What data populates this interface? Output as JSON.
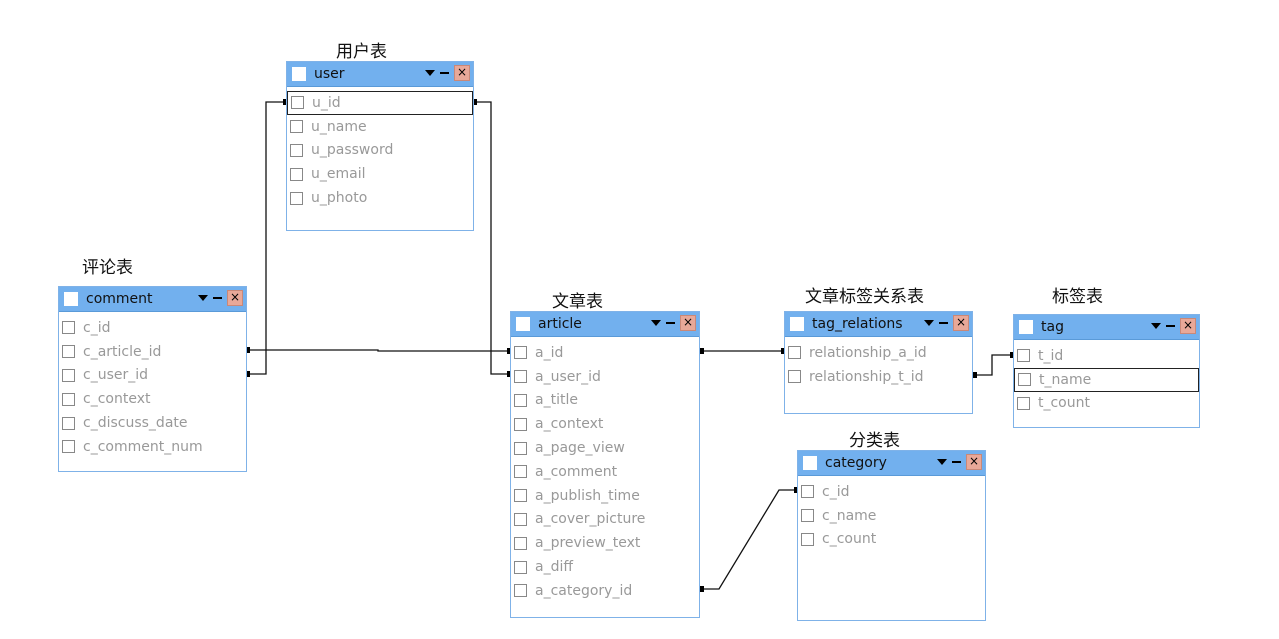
{
  "tables": [
    {
      "id": "user",
      "caption": "用户表",
      "name": "user",
      "fields": [
        "u_id",
        "u_name",
        "u_password",
        "u_email",
        "u_photo"
      ],
      "selected": 0
    },
    {
      "id": "comment",
      "caption": "评论表",
      "name": "comment",
      "fields": [
        "c_id",
        "c_article_id",
        "c_user_id",
        "c_context",
        "c_discuss_date",
        "c_comment_num"
      ],
      "selected": -1
    },
    {
      "id": "article",
      "caption": "文章表",
      "name": "article",
      "fields": [
        "a_id",
        "a_user_id",
        "a_title",
        "a_context",
        "a_page_view",
        "a_comment",
        "a_publish_time",
        "a_cover_picture",
        "a_preview_text",
        "a_diff",
        "a_category_id"
      ],
      "selected": -1
    },
    {
      "id": "tag_relations",
      "caption": "文章标签关系表",
      "name": "tag_relations",
      "fields": [
        "relationship_a_id",
        "relationship_t_id"
      ],
      "selected": -1
    },
    {
      "id": "tag",
      "caption": "标签表",
      "name": "tag",
      "fields": [
        "t_id",
        "t_name",
        "t_count"
      ],
      "selected": 1
    },
    {
      "id": "category",
      "caption": "分类表",
      "name": "category",
      "fields": [
        "c_id",
        "c_name",
        "c_count"
      ],
      "selected": -1
    }
  ],
  "close_glyph": "×"
}
